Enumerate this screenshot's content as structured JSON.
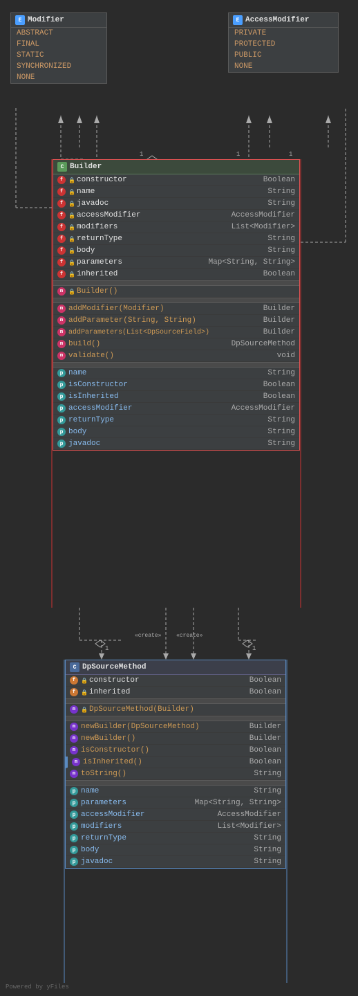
{
  "modifier_enum": {
    "title": "Modifier",
    "icon": "E",
    "items": [
      "ABSTRACT",
      "FINAL",
      "STATIC",
      "SYNCHRONIZED",
      "NONE"
    ]
  },
  "access_modifier_enum": {
    "title": "AccessModifier",
    "icon": "E",
    "items": [
      "PRIVATE",
      "PROTECTED",
      "PUBLIC",
      "NONE"
    ]
  },
  "builder_class": {
    "title": "Builder",
    "icon": "C",
    "fields": [
      {
        "name": "constructor",
        "type": "Boolean",
        "icon": "f",
        "lock": true
      },
      {
        "name": "name",
        "type": "String",
        "icon": "f",
        "lock": true
      },
      {
        "name": "javadoc",
        "type": "String",
        "icon": "f",
        "lock": true
      },
      {
        "name": "accessModifier",
        "type": "AccessModifier",
        "icon": "f",
        "lock": true
      },
      {
        "name": "modifiers",
        "type": "List<Modifier>",
        "icon": "f",
        "lock": true
      },
      {
        "name": "returnType",
        "type": "String",
        "icon": "f",
        "lock": true
      },
      {
        "name": "body",
        "type": "String",
        "icon": "f",
        "lock": true
      },
      {
        "name": "parameters",
        "type": "Map<String, String>",
        "icon": "f",
        "lock": true
      },
      {
        "name": "inherited",
        "type": "Boolean",
        "icon": "f",
        "lock": true
      }
    ],
    "constructors": [
      {
        "name": "Builder()",
        "icon": "m",
        "lock": true
      }
    ],
    "methods": [
      {
        "name": "addModifier(Modifier)",
        "return": "Builder",
        "icon": "m",
        "static": true
      },
      {
        "name": "addParameter(String, String)",
        "return": "Builder",
        "icon": "m",
        "static": true
      },
      {
        "name": "addParameters(List<DpSourceField>)",
        "return": "Builder",
        "icon": "m",
        "static": true
      },
      {
        "name": "build()",
        "return": "DpSourceMethod",
        "icon": "m",
        "static": true
      },
      {
        "name": "validate()",
        "return": "void",
        "icon": "m",
        "static": true
      }
    ],
    "properties": [
      {
        "name": "name",
        "type": "String"
      },
      {
        "name": "isConstructor",
        "type": "Boolean"
      },
      {
        "name": "isInherited",
        "type": "Boolean"
      },
      {
        "name": "accessModifier",
        "type": "AccessModifier"
      },
      {
        "name": "returnType",
        "type": "String"
      },
      {
        "name": "body",
        "type": "String"
      },
      {
        "name": "javadoc",
        "type": "String"
      }
    ]
  },
  "dp_source_method_class": {
    "title": "DpSourceMethod",
    "icon": "C",
    "fields": [
      {
        "name": "constructor",
        "type": "Boolean",
        "icon": "f",
        "lock": true
      },
      {
        "name": "inherited",
        "type": "Boolean",
        "icon": "f",
        "lock": true
      }
    ],
    "constructors": [
      {
        "name": "DpSourceMethod(Builder)",
        "icon": "m",
        "lock": true
      }
    ],
    "methods": [
      {
        "name": "newBuilder(DpSourceMethod)",
        "return": "Builder",
        "icon": "m",
        "static": true
      },
      {
        "name": "newBuilder()",
        "return": "Builder",
        "icon": "m",
        "static": true
      },
      {
        "name": "isConstructor()",
        "return": "Boolean",
        "icon": "m",
        "static": true
      },
      {
        "name": "isInherited()",
        "return": "Boolean",
        "icon": "m",
        "static": true
      },
      {
        "name": "toString()",
        "return": "String",
        "icon": "m",
        "static": true
      }
    ],
    "properties": [
      {
        "name": "name",
        "type": "String"
      },
      {
        "name": "parameters",
        "type": "Map<String, String>"
      },
      {
        "name": "accessModifier",
        "type": "AccessModifier"
      },
      {
        "name": "modifiers",
        "type": "List<Modifier>"
      },
      {
        "name": "returnType",
        "type": "String"
      },
      {
        "name": "body",
        "type": "String"
      },
      {
        "name": "javadoc",
        "type": "String"
      }
    ]
  },
  "powered_by": "Powered by yFiles"
}
